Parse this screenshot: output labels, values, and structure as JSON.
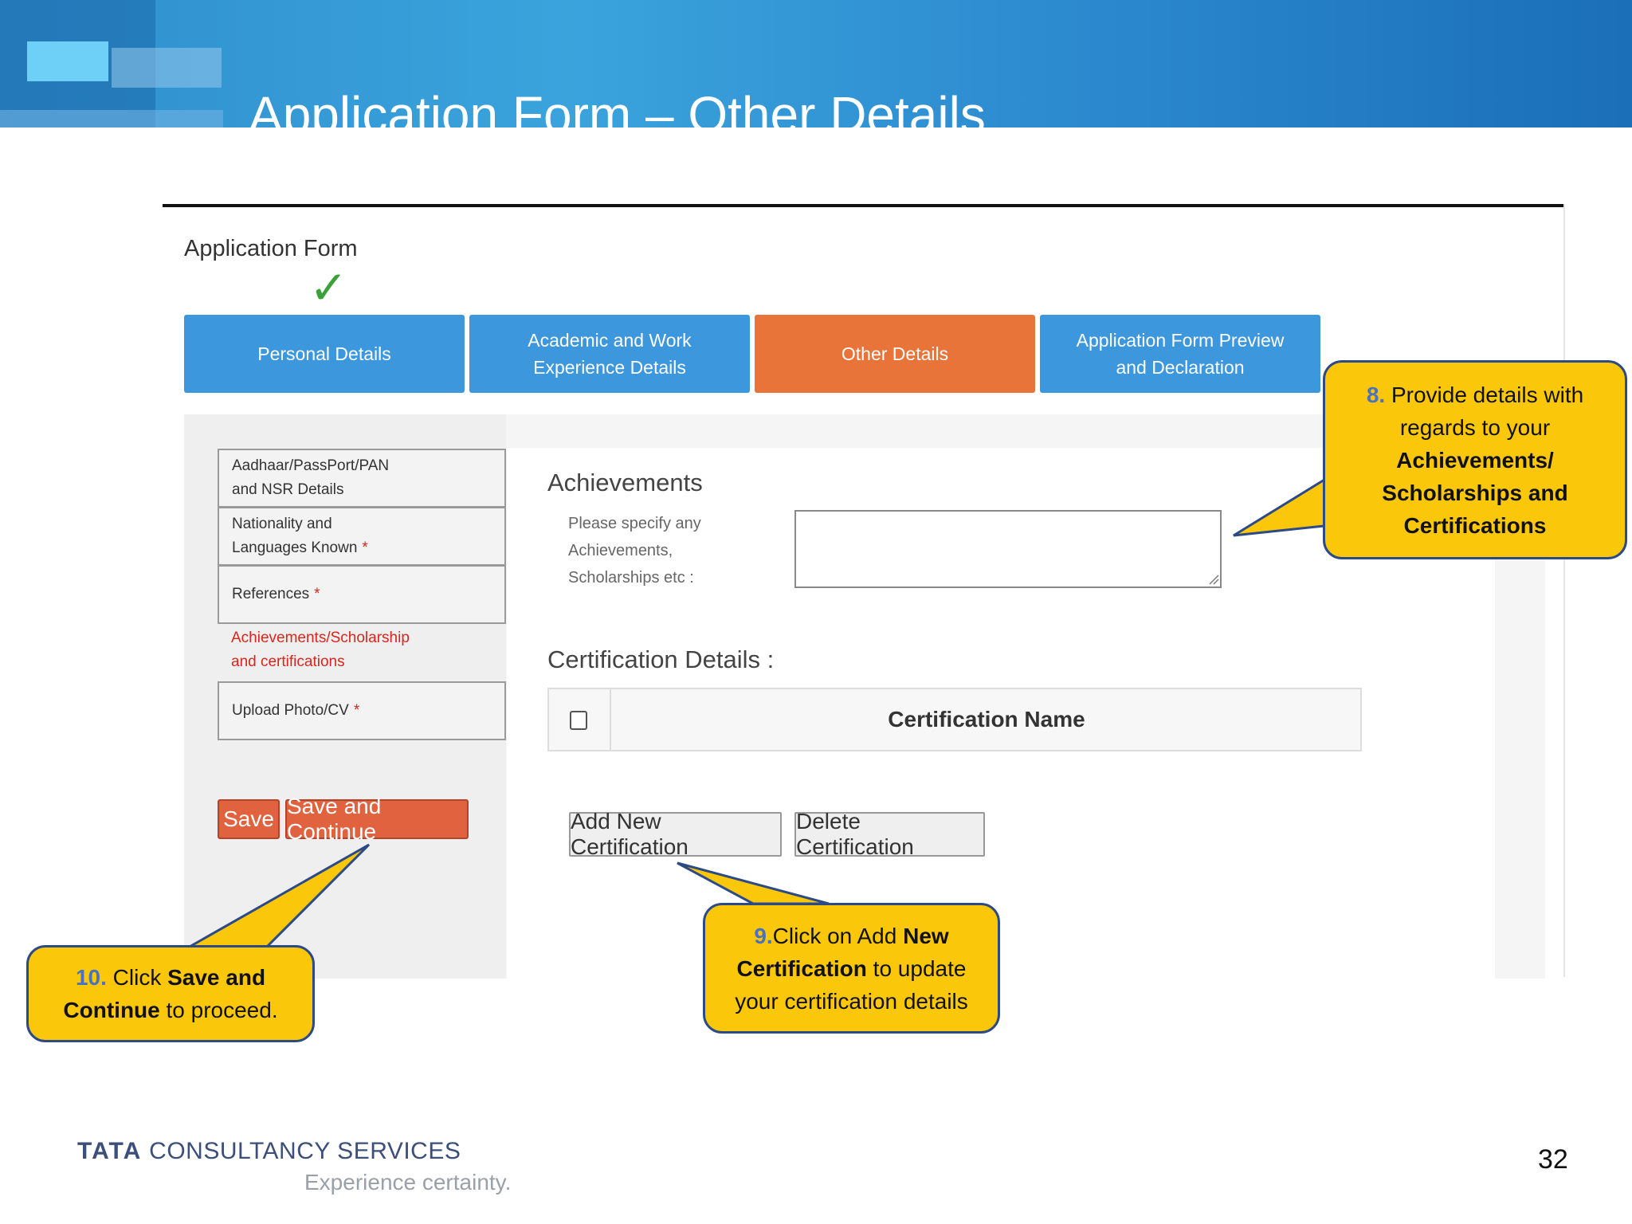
{
  "slide": {
    "title": "Application Form – Other Details",
    "page_number": "32",
    "brand_colors": {
      "banner": "#2a86cd",
      "callout_fill": "#fbc70a",
      "callout_border": "#2c4a86"
    }
  },
  "form": {
    "heading": "Application Form",
    "completed_mark": "✓",
    "steps": [
      {
        "label_line1": "Personal Details",
        "label_line2": "",
        "state": "completed",
        "color": "#3d97dc"
      },
      {
        "label_line1": "Academic and Work",
        "label_line2": "Experience Details",
        "state": "pending",
        "color": "#3d97dc"
      },
      {
        "label_line1": "Other Details",
        "label_line2": "",
        "state": "active",
        "color": "#e9743a"
      },
      {
        "label_line1": "Application Form Preview",
        "label_line2": "and Declaration",
        "state": "pending",
        "color": "#3d97dc"
      }
    ]
  },
  "sidebar": {
    "items": [
      {
        "line1": "Aadhaar/PassPort/PAN",
        "line2": "and NSR Details",
        "required": ""
      },
      {
        "line1": "Nationality and",
        "line2": "Languages Known",
        "required": "*"
      },
      {
        "line1": "References",
        "line2": "",
        "required": "*"
      },
      {
        "line1": "Achievements/Scholarship",
        "line2": "and certifications",
        "required": "",
        "active": true
      },
      {
        "line1": "Upload Photo/CV",
        "line2": "",
        "required": "*"
      }
    ],
    "save_label": "Save",
    "save_continue_label": "Save and Continue"
  },
  "achievements": {
    "title": "Achievements",
    "help_line1": "Please specify any",
    "help_line2": "Achievements,",
    "help_line3": "Scholarships etc :",
    "value": ""
  },
  "certifications": {
    "title": "Certification Details :",
    "column_header": "Certification Name",
    "rows": [],
    "add_label": "Add New Certification",
    "delete_label": "Delete Certification"
  },
  "callouts": {
    "c8": {
      "num": "8.",
      "line1": "Provide details with",
      "line2": "regards to your",
      "bold1": "Achievements/",
      "bold2": "Scholarships and",
      "bold3": "Certifications"
    },
    "c9": {
      "num": "9.",
      "text1": "Click on Add ",
      "bold1": "New",
      "bold2": "Certification",
      "text2": " to update",
      "line3": "your certification details"
    },
    "c10": {
      "num": "10.",
      "text1": " Click ",
      "bold1": "Save and",
      "bold2": "Continue",
      "text2": " to proceed."
    }
  },
  "footer": {
    "logo_strong": "TATA",
    "logo_rest": " CONSULTANCY SERVICES",
    "tagline": "Experience certainty."
  }
}
